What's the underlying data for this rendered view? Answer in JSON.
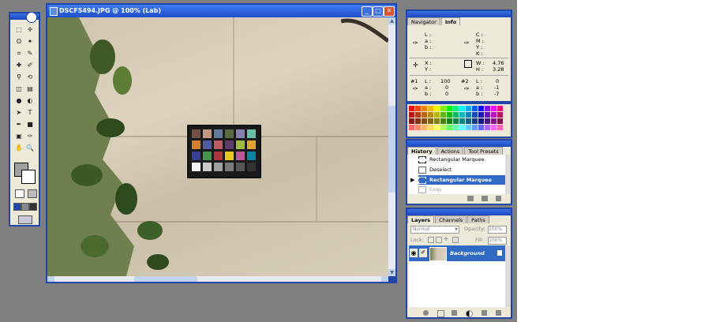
{
  "document_window": {
    "title": "DSCF5494.JPG @ 100% (Lab)",
    "buttons": {
      "minimize": "_",
      "maximize": "□",
      "close": "✕"
    }
  },
  "toolbox": {
    "tools": [
      "rect-marquee",
      "move",
      "lasso",
      "magic-wand",
      "crop",
      "slice",
      "healing-brush",
      "brush",
      "clone-stamp",
      "history-brush",
      "eraser",
      "gradient",
      "blur",
      "dodge",
      "path-select",
      "type",
      "pen",
      "shape",
      "notes",
      "eyedropper",
      "hand",
      "zoom"
    ],
    "glyphs": [
      "⬚",
      "✛",
      "ʘ",
      "✦",
      "⌗",
      "✎",
      "✚",
      "✐",
      "⚲",
      "⟲",
      "◫",
      "▤",
      "●",
      "◐",
      "➤",
      "T",
      "✒",
      "■",
      "▣",
      "✑",
      "✋",
      "🔍"
    ]
  },
  "navigator": {
    "tabs": [
      "Navigator",
      "Info"
    ],
    "lab_labels": [
      "L :",
      "a :",
      "b :"
    ],
    "cmyk_labels": [
      "C :",
      "M :",
      "Y :",
      "K :"
    ],
    "xy_labels": [
      "X :",
      "Y :"
    ],
    "wh_labels": [
      "W :",
      "H :"
    ],
    "w_value": "4.76",
    "h_value": "3.28",
    "sample1": {
      "id": "#1",
      "labels": [
        "L :",
        "a :",
        "b :"
      ],
      "values": [
        "100",
        "0",
        "0"
      ]
    },
    "sample2": {
      "id": "#2",
      "labels": [
        "L :",
        "a :",
        "b :"
      ],
      "values": [
        "0",
        "-1",
        "-7"
      ]
    }
  },
  "history": {
    "tabs": [
      "History",
      "Actions",
      "Tool Presets"
    ],
    "items": [
      "Rectangular Marquee",
      "Deselect",
      "Rectangular Marquee",
      "Crop"
    ]
  },
  "layers": {
    "tabs": [
      "Layers",
      "Channels",
      "Paths"
    ],
    "blend_mode": "Normal",
    "opacity_label": "Opacity:",
    "opacity_value": "100%",
    "lock_label": "Lock:",
    "fill_label": "Fill:",
    "fill_value": "100%",
    "layer_name": "Background"
  },
  "colors": {
    "xp_blue": "#2146a8",
    "selected": "#316ac5",
    "panel": "#ece9d8"
  }
}
